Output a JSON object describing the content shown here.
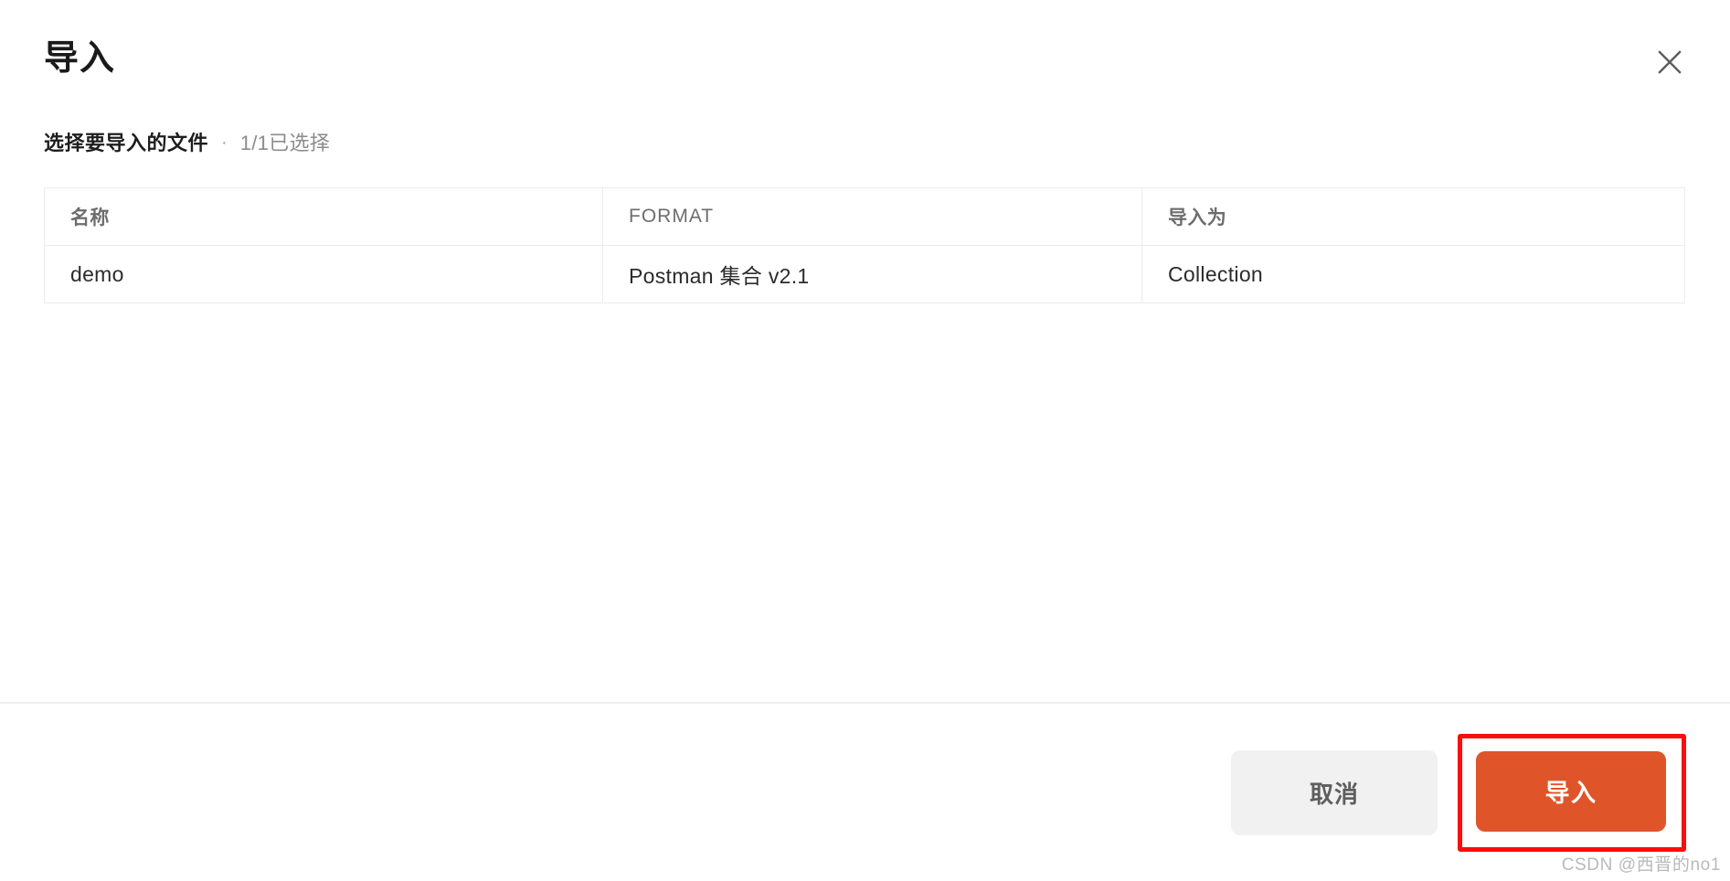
{
  "dialog": {
    "title": "导入",
    "close_icon": "close-icon"
  },
  "section": {
    "heading": "选择要导入的文件",
    "separator": "·",
    "selection_count": "1/1已选择"
  },
  "table": {
    "columns": [
      "名称",
      "FORMAT",
      "导入为"
    ],
    "rows": [
      {
        "name": "demo",
        "format": "Postman 集合 v2.1",
        "import_as": "Collection"
      }
    ]
  },
  "footer": {
    "cancel_label": "取消",
    "import_label": "导入"
  },
  "annotation": {
    "highlight_color": "#fb0d0d"
  },
  "colors": {
    "primary": "#e0542a",
    "cancel_bg": "#f1f1f1",
    "border": "#ececec",
    "highlight": "#fb0d0d"
  },
  "watermark": {
    "text": "CSDN @西晋的no1"
  }
}
